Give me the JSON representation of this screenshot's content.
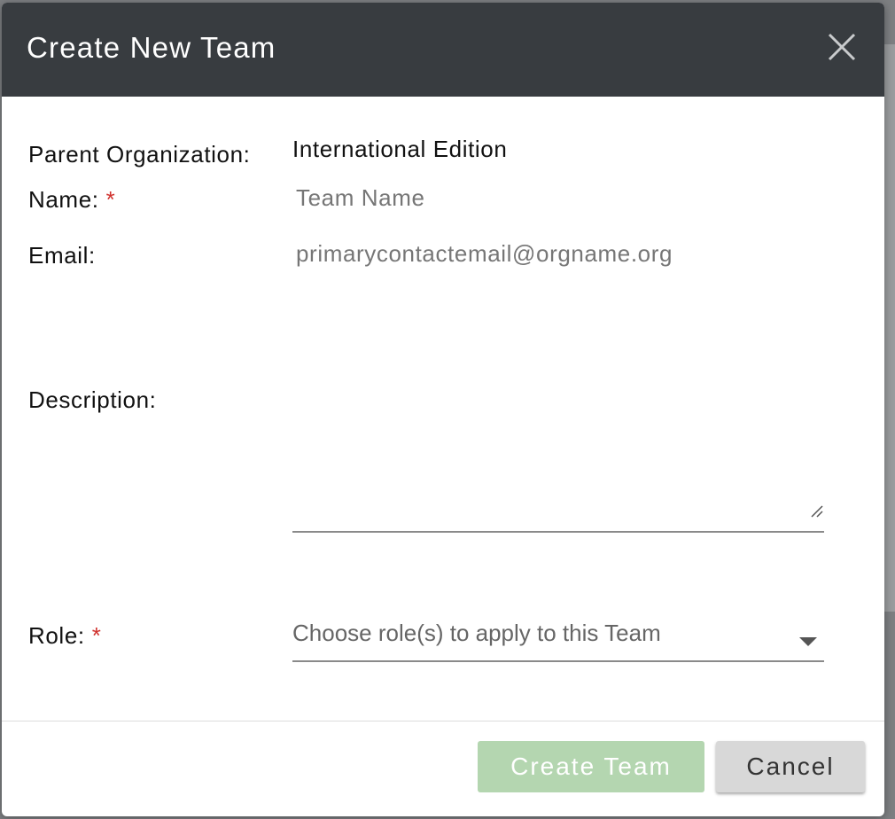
{
  "dialog": {
    "title": "Create New Team",
    "close_icon": "close-icon"
  },
  "form": {
    "parent_org_label": "Parent Organization:",
    "parent_org_value": "International Edition",
    "name_label": "Name:",
    "name_required_mark": "*",
    "name_placeholder": "Team Name",
    "name_value": "",
    "email_label": "Email:",
    "email_placeholder": "primarycontactemail@orgname.org",
    "email_value": "",
    "description_label": "Description:",
    "description_value": "",
    "role_label": "Role:",
    "role_required_mark": "*",
    "role_placeholder": "Choose role(s) to apply to this Team"
  },
  "footer": {
    "create_label": "Create Team",
    "cancel_label": "Cancel"
  },
  "colors": {
    "header_bg": "#383c40",
    "required": "#d0312d",
    "create_button_disabled": "#b4d6b0",
    "cancel_button": "#d8d8d8"
  }
}
